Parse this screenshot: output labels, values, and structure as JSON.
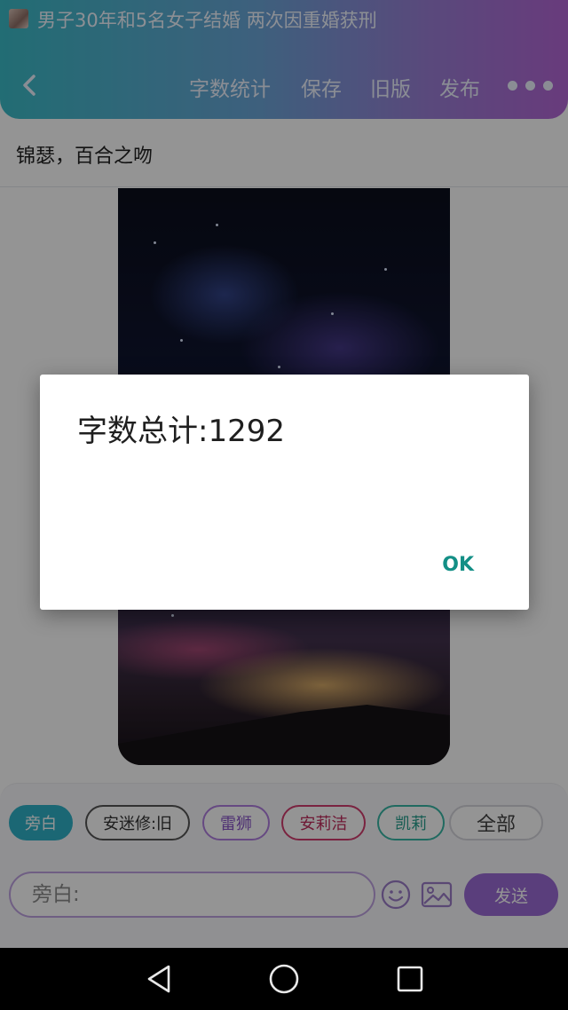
{
  "notification": {
    "headline": "男子30年和5名女子结婚 两次因重婚获刑"
  },
  "toolbar": {
    "word_count": "字数统计",
    "save": "保存",
    "old_version": "旧版",
    "publish": "发布"
  },
  "document": {
    "title": "锦瑟，百合之吻"
  },
  "characters": [
    {
      "label": "旁白",
      "color": "#2fb2c8"
    },
    {
      "label": "安迷修:旧",
      "color": "#555555"
    },
    {
      "label": "雷狮",
      "color": "#b07fe0"
    },
    {
      "label": "安莉洁",
      "color": "#d23d6e"
    },
    {
      "label": "凯莉",
      "color": "#38b7a5"
    },
    {
      "label": "全部",
      "color": "#d6d6dc"
    }
  ],
  "composer": {
    "placeholder": "旁白:",
    "send": "发送"
  },
  "dialog": {
    "message": "字数总计:1292",
    "ok": "OK"
  },
  "colors": {
    "accent": "#9b6bd6",
    "dialog_button": "#138f86"
  },
  "icons": [
    "back-arrow-icon",
    "more-icon",
    "emoji-icon",
    "image-icon",
    "nav-back-icon",
    "nav-home-icon",
    "nav-recent-icon"
  ]
}
